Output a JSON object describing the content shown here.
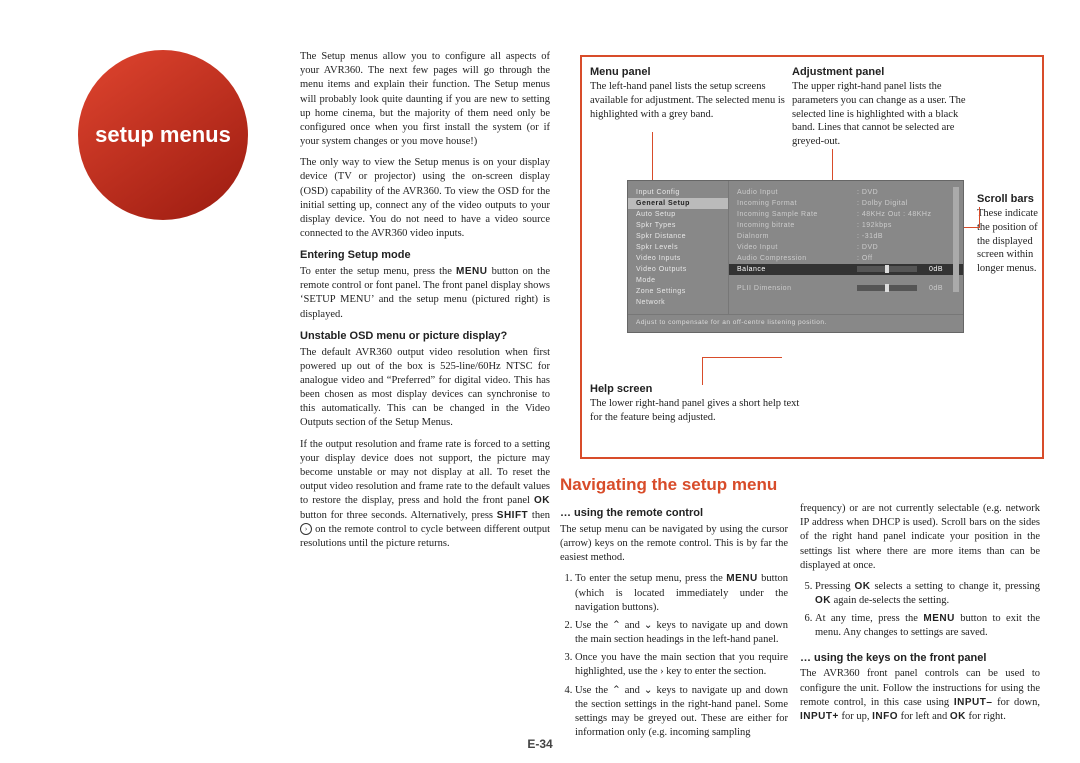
{
  "circle_title": "setup menus",
  "col1": {
    "p1": "The Setup menus allow you to configure all aspects of your AVR360. The next few pages will go through the menu items and explain their function. The Setup menus will probably look quite daunting if you are new to setting up home cinema, but the majority of them need only be configured once when you first install the system (or if your system changes or you move house!)",
    "p2": "The only way to view the Setup menus is on your display device (TV or projector) using the on-screen display (OSD) capability of the AVR360. To view the OSD for the initial setting up, connect any of the video outputs to your display device. You do not need to have a video source connected to the AVR360 video inputs.",
    "h_enter": "Entering Setup mode",
    "p3a": "To enter the setup menu, press the ",
    "p3b": " button on the remote control or font panel. The front panel display shows ‘SETUP  MENU’ and the setup menu (pictured right) is displayed.",
    "menu_sc": "MENU",
    "h_unstable": "Unstable OSD menu or picture display?",
    "p4": "The default AVR360 output video resolution when first powered up out of the box is 525-line/60Hz NTSC for analogue video and “Preferred” for digital video. This has been chosen as most display devices can synchronise to this automatically. This can be changed in the Video Outputs section of the Setup Menus.",
    "p5a": "If the output resolution and frame rate is forced to a setting your display device does not support, the picture may become unstable or may not display at all. To reset the output video resolution and frame rate to the default values to restore the display, press and hold the front panel ",
    "ok_sc": "OK",
    "p5b": " button for three seconds. Alternatively, press ",
    "shift_sc": "SHIFT",
    "p5c": " then ",
    "p5d": " on the remote control to cycle between different output resolutions until the picture returns."
  },
  "diagram": {
    "menu_panel_h": "Menu panel",
    "menu_panel_t": "The left-hand panel lists the setup screens available for adjustment. The selected menu is highlighted with a grey band.",
    "adj_panel_h": "Adjustment panel",
    "adj_panel_t": "The upper right-hand panel lists the parameters you can change as a user. The selected line is highlighted with a black band. Lines that cannot be selected are greyed-out.",
    "scroll_h": "Scroll bars",
    "scroll_t": "These indicate the position of the displayed screen within longer menus.",
    "help_h": "Help screen",
    "help_t": "The lower right-hand panel gives a short help text for the feature being adjusted."
  },
  "osd": {
    "left_items": [
      "Input Config",
      "General Setup",
      "Auto Setup",
      "Spkr Types",
      "Spkr Distance",
      "Spkr Levels",
      "Video Inputs",
      "Video Outputs",
      "Mode",
      "Zone Settings",
      "Network"
    ],
    "left_selected_index": 1,
    "rows": [
      {
        "k": "Audio Input",
        "v": ": DVD"
      },
      {
        "k": "Incoming Format",
        "v": ": Dolby Digital"
      },
      {
        "k": "Incoming Sample Rate",
        "v": ": 48KHz Out : 48KHz"
      },
      {
        "k": "Incoming bitrate",
        "v": ": 192kbps"
      },
      {
        "k": "Dialnorm",
        "v": ": -31dB"
      },
      {
        "k": "Video Input",
        "v": ": DVD"
      },
      {
        "k": "Audio Compression",
        "v": ": Off"
      },
      {
        "k": "Balance",
        "v": "slider",
        "end": "0dB",
        "dark": true
      },
      {
        "k": "",
        "v": "",
        "spacer": true
      },
      {
        "k": "PLII Dimension",
        "v": "slider",
        "end": "0dB"
      }
    ],
    "help": "Adjust to compensate for an off-centre listening position."
  },
  "nav": {
    "heading": "Navigating the setup menu",
    "h_remote": "… using the remote control",
    "remote_intro": "The setup menu can be navigated by using the cursor (arrow) keys on the remote control. This is by far the easiest method.",
    "li1a": "To enter the setup menu, press the ",
    "li1b": " button (which is located immediately under the navigation buttons).",
    "li2": "Use the ⌃ and ⌄ keys to navigate up and down the main section headings in the left-hand panel.",
    "li3": "Once you have the main section that you require highlighted, use the › key to enter the section.",
    "li4": "Use the ⌃ and ⌄ keys to navigate up and down the section settings in the right-hand panel. Some settings may be greyed out. These are either for information only (e.g. incoming sampling",
    "right_p1": "frequency) or are not currently selectable (e.g. network IP address when DHCP is used). Scroll bars on the sides of the right hand panel indicate your position in the settings list where there are more items than can be displayed at once.",
    "li5a": "Pressing ",
    "li5b": " selects a setting to change it, pressing ",
    "li5c": " again de-selects the setting.",
    "li6a": "At any time, press the ",
    "li6b": " button to exit the menu. Any changes to settings are saved.",
    "h_front": "… using the keys on the front panel",
    "front_p_a": "The AVR360 front panel controls can be used to configure the unit. Follow the instructions for using the remote control, in this case using ",
    "inputm_sc": "INPUT–",
    "front_p_b": " for down, ",
    "inputp_sc": "INPUT+",
    "front_p_c": " for up, ",
    "info_sc": "INFO",
    "front_p_d": " for left and ",
    "front_p_e": " for right."
  },
  "page_number": "E-34"
}
